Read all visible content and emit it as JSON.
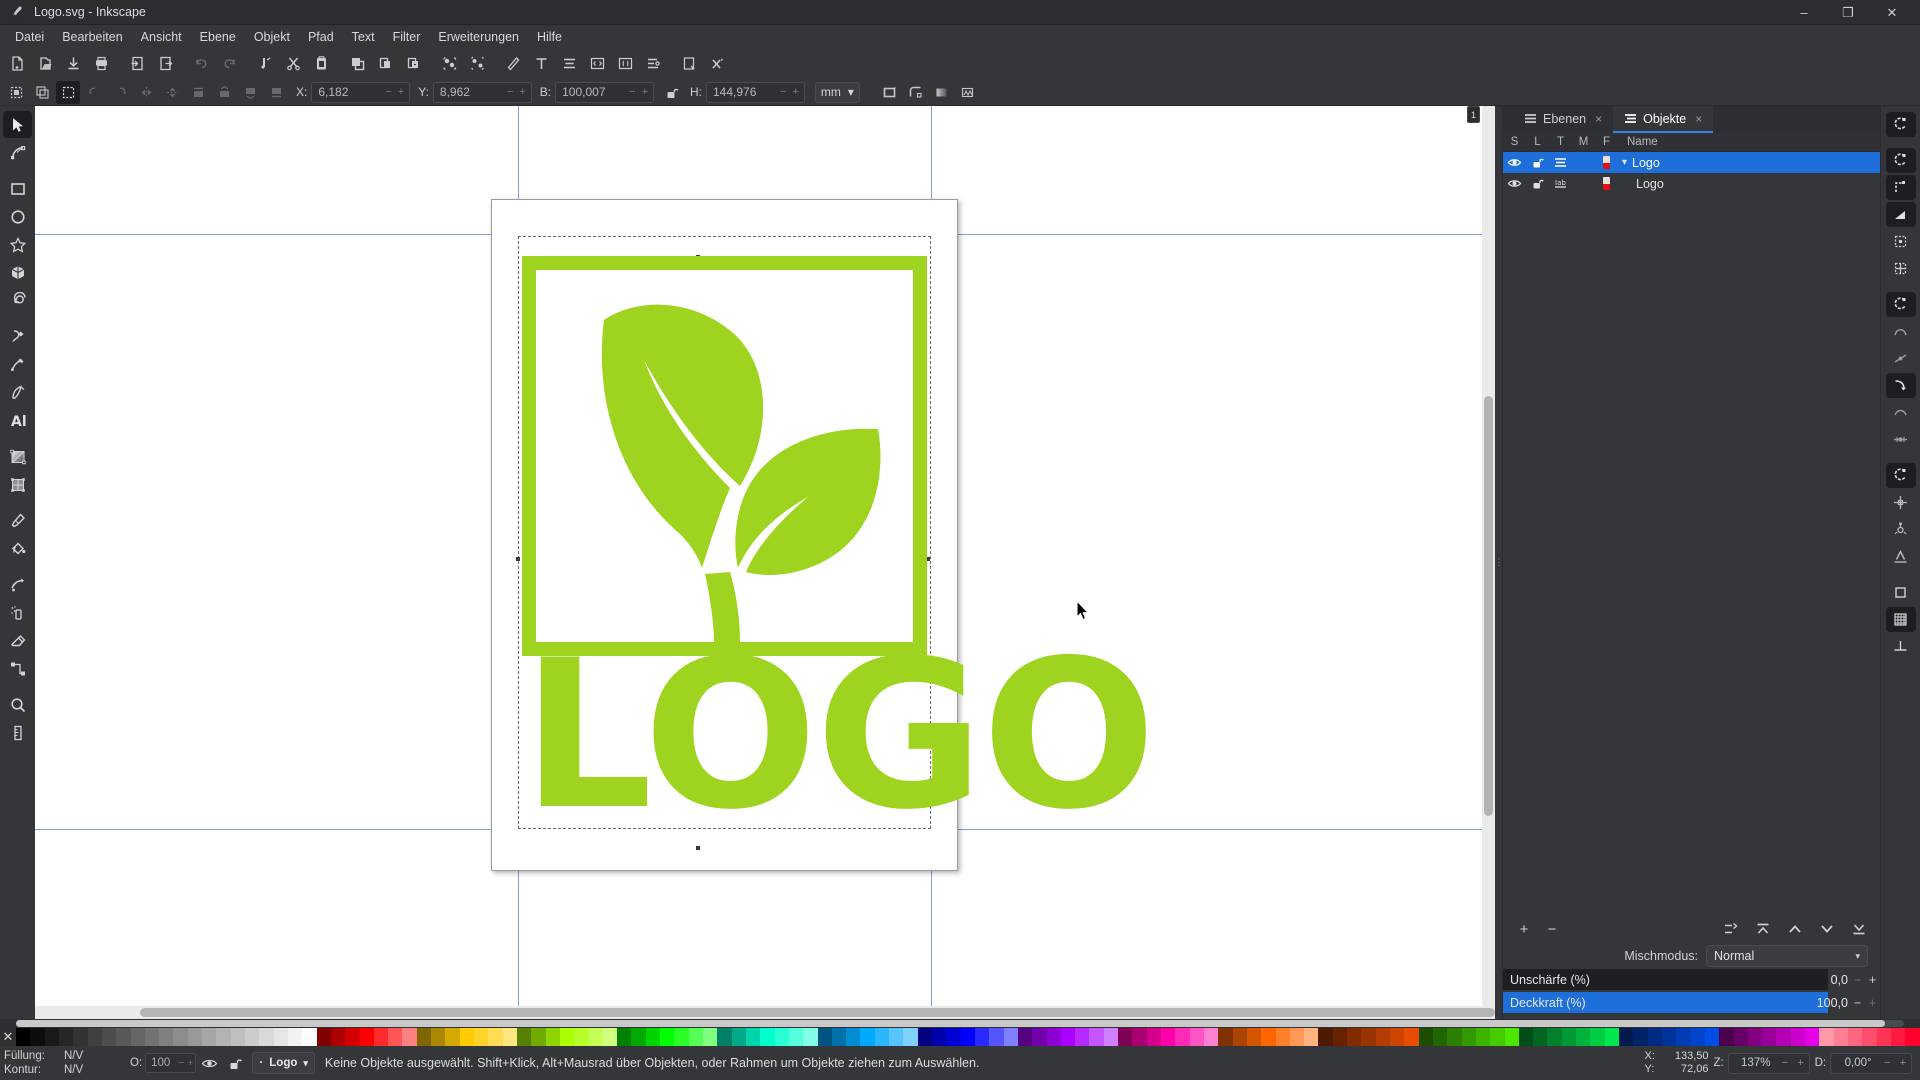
{
  "window": {
    "title": "Logo.svg - Inkscape",
    "app_icon": "inkscape-icon",
    "minimize": "–",
    "maximize": "❐",
    "close": "✕"
  },
  "menubar": {
    "items": [
      {
        "label": "Datei",
        "name": "menu-datei"
      },
      {
        "label": "Bearbeiten",
        "name": "menu-bearbeiten"
      },
      {
        "label": "Ansicht",
        "name": "menu-ansicht"
      },
      {
        "label": "Ebene",
        "name": "menu-ebene"
      },
      {
        "label": "Objekt",
        "name": "menu-objekt"
      },
      {
        "label": "Pfad",
        "name": "menu-pfad"
      },
      {
        "label": "Text",
        "name": "menu-text"
      },
      {
        "label": "Filter",
        "name": "menu-filter"
      },
      {
        "label": "Erweiterungen",
        "name": "menu-erweiterungen"
      },
      {
        "label": "Hilfe",
        "name": "menu-hilfe"
      }
    ]
  },
  "commandbar": {
    "buttons": [
      "new-document-icon",
      "open-document-icon",
      "save-document-icon",
      "print-icon",
      "import-icon",
      "export-icon",
      "undo-icon",
      "redo-icon",
      "cut-icon",
      "scissors-icon",
      "paste-icon",
      "copy-icon",
      "duplicate-icon",
      "clone-icon",
      "group-icon",
      "ungroup-icon",
      "fill-stroke-icon",
      "text-tool-icon",
      "align-icon",
      "xml-editor-icon",
      "document-properties-icon",
      "preferences-icon"
    ]
  },
  "tooloptions": {
    "select_all_icon": "select-all-icon",
    "select_all_layers_icon": "select-all-layers-icon",
    "deselect_icon": "deselect-icon",
    "rotate_ccw_icon": "rotate-ccw-icon",
    "rotate_cw_icon": "rotate-cw-icon",
    "flip_h_icon": "flip-horizontal-icon",
    "flip_v_icon": "flip-vertical-icon",
    "raise_top_icon": "raise-to-top-icon",
    "raise_icon": "raise-icon",
    "lower_icon": "lower-icon",
    "lower_bottom_icon": "lower-to-bottom-icon",
    "x_label": "X:",
    "x_value": "6,182",
    "y_label": "Y:",
    "y_value": "8,962",
    "w_label": "B:",
    "w_value": "100,007",
    "h_label": "H:",
    "h_value": "144,976",
    "lock_icon": "lock-open-icon",
    "unit": "mm",
    "unit_caret": "▾",
    "minus": "−",
    "plus": "+",
    "affect_buttons": [
      "affect-stroke-width-icon",
      "affect-corners-icon",
      "affect-gradients-icon",
      "affect-patterns-icon"
    ]
  },
  "toolbox": {
    "tools": [
      {
        "name": "selector-tool",
        "active": true
      },
      {
        "name": "node-tool",
        "active": false
      },
      {
        "name": "rectangle-tool",
        "active": false
      },
      {
        "name": "ellipse-tool",
        "active": false
      },
      {
        "name": "star-tool",
        "active": false
      },
      {
        "name": "box3d-tool",
        "active": false
      },
      {
        "name": "spiral-tool",
        "active": false
      },
      {
        "name": "pencil-tool",
        "active": false
      },
      {
        "name": "bezier-tool",
        "active": false
      },
      {
        "name": "calligraphy-tool",
        "active": false
      },
      {
        "name": "text-tool",
        "active": false
      },
      {
        "name": "gradient-tool",
        "active": false
      },
      {
        "name": "mesh-tool",
        "active": false
      },
      {
        "name": "dropper-tool",
        "active": false
      },
      {
        "name": "paintbucket-tool",
        "active": false
      },
      {
        "name": "tweak-tool",
        "active": false
      },
      {
        "name": "spray-tool",
        "active": false
      },
      {
        "name": "eraser-tool",
        "active": false
      },
      {
        "name": "connector-tool",
        "active": false
      },
      {
        "name": "zoom-tool",
        "active": false
      },
      {
        "name": "measure-tool",
        "active": false
      }
    ]
  },
  "canvas": {
    "snap_badge": "1",
    "artwork": {
      "name": "plant-logo",
      "green": "#9ed420",
      "wordmark": "LOGO"
    }
  },
  "dock": {
    "tabs": [
      {
        "label": "Ebenen",
        "name": "tab-ebenen",
        "active": false,
        "close": "×"
      },
      {
        "label": "Objekte",
        "name": "tab-objekte",
        "active": true,
        "close": "×"
      }
    ],
    "columns": [
      "S",
      "L",
      "T",
      "M",
      "F"
    ],
    "name_column": "Name",
    "rows": [
      {
        "label": "Logo",
        "selected": true,
        "expander": "▾",
        "visibility_icon": "eye-icon",
        "lock_icon": "lock-open-icon",
        "type_icon": "layers-icon",
        "fill_top": "#e8e0da",
        "fill_bottom": "#e01010"
      },
      {
        "label": "Logo",
        "selected": false,
        "expander": "",
        "visibility_icon": "eye-icon",
        "lock_icon": "lock-open-icon",
        "type_icon": "label-icon",
        "fill_top": "#e8e0da",
        "fill_bottom": "#e01010"
      }
    ],
    "footer_buttons": [
      {
        "name": "add-object-button",
        "glyph": "+"
      },
      {
        "name": "remove-object-button",
        "glyph": "−"
      }
    ],
    "arrange_buttons": [
      "move-to-layer-icon",
      "raise-to-top-icon",
      "raise-icon",
      "lower-icon",
      "lower-to-bottom-icon"
    ],
    "blend_label": "Mischmodus:",
    "blend_value": "Normal",
    "blend_caret": "▾",
    "blur_label": "Unschärfe (%)",
    "blur_value": "0,0",
    "opacity_label": "Deckkraft (%)",
    "opacity_value": "100,0",
    "minus": "−",
    "plus": "+",
    "opacity_percent": 100
  },
  "rail": {
    "buttons": [
      {
        "name": "snap-bbox-icon",
        "on": true
      },
      {
        "name": "snap-nodes-icon",
        "on": true
      },
      {
        "name": "snap-bbox-corner-icon",
        "on": true
      },
      {
        "name": "snap-bbox-edge-midpoint-icon",
        "on": true
      },
      {
        "name": "snap-bbox-center-icon",
        "on": false
      },
      {
        "name": "snap-bbox-edge-center-icon",
        "on": false
      },
      {
        "name": "snap-node-paths-icon",
        "on": true
      },
      {
        "name": "snap-path-intersection-icon",
        "on": false
      },
      {
        "name": "snap-cusp-node-icon",
        "on": false
      },
      {
        "name": "snap-smooth-node-icon",
        "on": true
      },
      {
        "name": "snap-midpoint-line-icon",
        "on": false
      },
      {
        "name": "snap-object-center-icon",
        "on": false
      },
      {
        "name": "snap-others-icon",
        "on": true
      },
      {
        "name": "snap-rotation-center-icon",
        "on": false
      },
      {
        "name": "snap-object-midpoint-icon",
        "on": false
      },
      {
        "name": "snap-text-baseline-icon",
        "on": false
      },
      {
        "name": "snap-page-border-icon",
        "on": false
      },
      {
        "name": "snap-grid-icon",
        "on": true
      },
      {
        "name": "snap-guide-icon",
        "on": false
      }
    ]
  },
  "palette": {
    "none_glyph": "✕",
    "none_name": "no-color-swatch",
    "colors": [
      "#000000",
      "#0d0d0d",
      "#1a1a1a",
      "#262626",
      "#333333",
      "#404040",
      "#4d4d4d",
      "#595959",
      "#666666",
      "#737373",
      "#808080",
      "#8c8c8c",
      "#999999",
      "#a6a6a6",
      "#b3b3b3",
      "#bfbfbf",
      "#cccccc",
      "#d9d9d9",
      "#e6e6e6",
      "#f2f2f2",
      "#ffffff",
      "#800000",
      "#aa0000",
      "#d40000",
      "#ff0000",
      "#ff2a2a",
      "#ff5555",
      "#ff8080",
      "#806600",
      "#aa8800",
      "#d4aa00",
      "#ffcc00",
      "#ffd42a",
      "#ffdd55",
      "#ffe680",
      "#558000",
      "#71aa00",
      "#8dd400",
      "#aaff00",
      "#b7ff2a",
      "#c4ff55",
      "#d1ff80",
      "#008000",
      "#00aa00",
      "#00d400",
      "#00ff00",
      "#2aff2a",
      "#55ff55",
      "#80ff80",
      "#008066",
      "#00aa88",
      "#00d4aa",
      "#00ffcc",
      "#2affd5",
      "#55ffdd",
      "#80ffe6",
      "#005580",
      "#0071aa",
      "#008dd4",
      "#00aaff",
      "#2ab7ff",
      "#55c4ff",
      "#80d1ff",
      "#000080",
      "#0000aa",
      "#0000d4",
      "#0000ff",
      "#2a2aff",
      "#5555ff",
      "#8080ff",
      "#550080",
      "#7100aa",
      "#8d00d4",
      "#aa00ff",
      "#b72aff",
      "#c455ff",
      "#d180ff",
      "#800055",
      "#aa0071",
      "#d4008d",
      "#ff00aa",
      "#ff2ab7",
      "#ff55c4",
      "#ff80d1",
      "#803300",
      "#aa4400",
      "#d45500",
      "#ff6600",
      "#ff802a",
      "#ff9955",
      "#ffb380",
      "#4d1a00",
      "#662200",
      "#802b00",
      "#993300",
      "#b33c00",
      "#cc4400",
      "#e64d00",
      "#1a4d00",
      "#226600",
      "#2b8000",
      "#339900",
      "#3cb300",
      "#44cc00",
      "#4de600",
      "#004d1a",
      "#006622",
      "#00802b",
      "#009933",
      "#00b33c",
      "#00cc44",
      "#00e64d",
      "#001a4d",
      "#002266",
      "#002b80",
      "#003399",
      "#003cb3",
      "#0044cc",
      "#004de6",
      "#4d004d",
      "#660066",
      "#800080",
      "#990099",
      "#b300b3",
      "#cc00cc",
      "#e600e6",
      "#ff99aa",
      "#ff8095",
      "#ff6680",
      "#ff4d6b",
      "#ff3356",
      "#ff1a41",
      "#ff002c"
    ]
  },
  "statusbar": {
    "fill_label": "Füllung:",
    "fill_value": "N/V",
    "stroke_label": "Kontur:",
    "stroke_value": "N/V",
    "opacity_label": "O:",
    "opacity_value": "100",
    "minus": "−",
    "plus": "+",
    "visibility_icon": "eye-icon",
    "lock_icon": "lock-open-icon",
    "layer_dot": "·",
    "layer_name": "Logo",
    "layer_caret": "▾",
    "message": "Keine Objekte ausgewählt. Shift+Klick, Alt+Mausrad über Objekten, oder Rahmen um Objekte ziehen zum Auswählen.",
    "x_label": "X:",
    "x_value": "133,50",
    "y_label": "Y:",
    "y_value": "72,06",
    "zoom_label": "Z:",
    "zoom_value": "137%",
    "rotation_label": "D:",
    "rotation_value": "0,00°"
  }
}
